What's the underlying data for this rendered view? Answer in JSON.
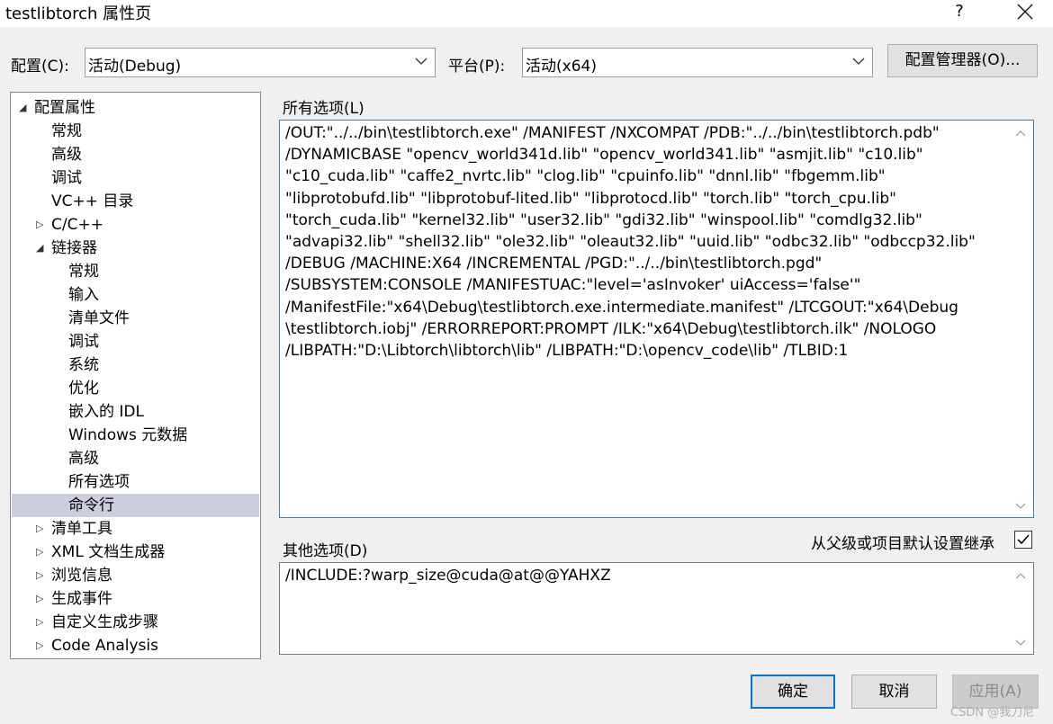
{
  "window": {
    "title": "testlibtorch 属性页",
    "help": "?"
  },
  "toolbar": {
    "config_label": "配置(C):",
    "config_value": "活动(Debug)",
    "platform_label": "平台(P):",
    "platform_value": "活动(x64)",
    "config_manager_button": "配置管理器(O)..."
  },
  "tree": [
    {
      "label": "配置属性",
      "arrow": "◢",
      "indent": 0
    },
    {
      "label": "常规",
      "arrow": "",
      "indent": 1
    },
    {
      "label": "高级",
      "arrow": "",
      "indent": 1
    },
    {
      "label": "调试",
      "arrow": "",
      "indent": 1
    },
    {
      "label": "VC++ 目录",
      "arrow": "",
      "indent": 1
    },
    {
      "label": "C/C++",
      "arrow": "▷",
      "indent": 1
    },
    {
      "label": "链接器",
      "arrow": "◢",
      "indent": 1
    },
    {
      "label": "常规",
      "arrow": "",
      "indent": 2
    },
    {
      "label": "输入",
      "arrow": "",
      "indent": 2
    },
    {
      "label": "清单文件",
      "arrow": "",
      "indent": 2
    },
    {
      "label": "调试",
      "arrow": "",
      "indent": 2
    },
    {
      "label": "系统",
      "arrow": "",
      "indent": 2
    },
    {
      "label": "优化",
      "arrow": "",
      "indent": 2
    },
    {
      "label": "嵌入的 IDL",
      "arrow": "",
      "indent": 2
    },
    {
      "label": "Windows 元数据",
      "arrow": "",
      "indent": 2
    },
    {
      "label": "高级",
      "arrow": "",
      "indent": 2
    },
    {
      "label": "所有选项",
      "arrow": "",
      "indent": 2
    },
    {
      "label": "命令行",
      "arrow": "",
      "indent": 2,
      "selected": true
    },
    {
      "label": "清单工具",
      "arrow": "▷",
      "indent": 1
    },
    {
      "label": "XML 文档生成器",
      "arrow": "▷",
      "indent": 1
    },
    {
      "label": "浏览信息",
      "arrow": "▷",
      "indent": 1
    },
    {
      "label": "生成事件",
      "arrow": "▷",
      "indent": 1
    },
    {
      "label": "自定义生成步骤",
      "arrow": "▷",
      "indent": 1
    },
    {
      "label": "Code Analysis",
      "arrow": "▷",
      "indent": 1
    }
  ],
  "all_options": {
    "label": "所有选项(L)",
    "lines": [
      "/OUT:\"../../bin\\testlibtorch.exe\" /MANIFEST /NXCOMPAT /PDB:\"../../bin\\testlibtorch.pdb\"",
      "/DYNAMICBASE \"opencv_world341d.lib\" \"opencv_world341.lib\" \"asmjit.lib\" \"c10.lib\"",
      "\"c10_cuda.lib\" \"caffe2_nvrtc.lib\" \"clog.lib\" \"cpuinfo.lib\" \"dnnl.lib\" \"fbgemm.lib\"",
      "\"libprotobufd.lib\" \"libprotobuf-lited.lib\" \"libprotocd.lib\" \"torch.lib\" \"torch_cpu.lib\"",
      "\"torch_cuda.lib\" \"kernel32.lib\" \"user32.lib\" \"gdi32.lib\" \"winspool.lib\" \"comdlg32.lib\"",
      "\"advapi32.lib\" \"shell32.lib\" \"ole32.lib\" \"oleaut32.lib\" \"uuid.lib\" \"odbc32.lib\" \"odbccp32.lib\"",
      "/DEBUG /MACHINE:X64 /INCREMENTAL /PGD:\"../../bin\\testlibtorch.pgd\"",
      "/SUBSYSTEM:CONSOLE /MANIFESTUAC:\"level='asInvoker' uiAccess='false'\"",
      "/ManifestFile:\"x64\\Debug\\testlibtorch.exe.intermediate.manifest\" /LTCGOUT:\"x64\\Debug",
      "\\testlibtorch.iobj\" /ERRORREPORT:PROMPT /ILK:\"x64\\Debug\\testlibtorch.ilk\" /NOLOGO",
      "/LIBPATH:\"D:\\Libtorch\\libtorch\\lib\" /LIBPATH:\"D:\\opencv_code\\lib\" /TLBID:1"
    ]
  },
  "other_options": {
    "label": "其他选项(D)",
    "inherit_label": "从父级或项目默认设置继承",
    "inherit_checked": true,
    "value": "/INCLUDE:?warp_size@cuda@at@@YAHXZ"
  },
  "buttons": {
    "ok": "确定",
    "cancel": "取消",
    "apply": "应用(A)"
  },
  "watermark": "CSDN @我刀尼"
}
